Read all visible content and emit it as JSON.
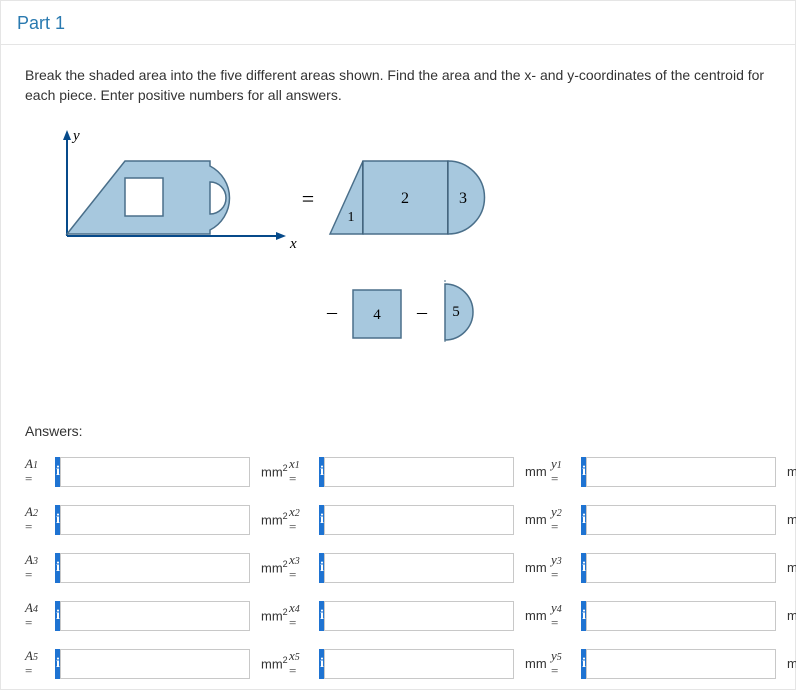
{
  "part": {
    "title": "Part 1"
  },
  "instructions": "Break the shaded area into the five different areas shown. Find the area and the x- and y-coordinates of the centroid for each piece. Enter positive numbers for all answers.",
  "diagram": {
    "y_label": "y",
    "x_label": "x",
    "eq_sign": "=",
    "minus_sign": "–",
    "piece_labels": [
      "1",
      "2",
      "3",
      "4",
      "5"
    ]
  },
  "answers_heading": "Answers:",
  "units": {
    "area": "mm",
    "area_sup": "2",
    "length": "mm"
  },
  "rows": [
    {
      "area_label_base": "A",
      "area_label_sub": "1",
      "x_label_base": "x",
      "x_label_sub": "1",
      "y_label_base": "y",
      "y_label_sub": "1",
      "area_val": "",
      "x_val": "",
      "y_val": ""
    },
    {
      "area_label_base": "A",
      "area_label_sub": "2",
      "x_label_base": "x",
      "x_label_sub": "2",
      "y_label_base": "y",
      "y_label_sub": "2",
      "area_val": "",
      "x_val": "",
      "y_val": ""
    },
    {
      "area_label_base": "A",
      "area_label_sub": "3",
      "x_label_base": "x",
      "x_label_sub": "3",
      "y_label_base": "y",
      "y_label_sub": "3",
      "area_val": "",
      "x_val": "",
      "y_val": ""
    },
    {
      "area_label_base": "A",
      "area_label_sub": "4",
      "x_label_base": "x",
      "x_label_sub": "4",
      "y_label_base": "y",
      "y_label_sub": "4",
      "area_val": "",
      "x_val": "",
      "y_val": ""
    },
    {
      "area_label_base": "A",
      "area_label_sub": "5",
      "x_label_base": "x",
      "x_label_sub": "5",
      "y_label_base": "y",
      "y_label_sub": "5",
      "area_val": "",
      "x_val": "",
      "y_val": ""
    }
  ]
}
